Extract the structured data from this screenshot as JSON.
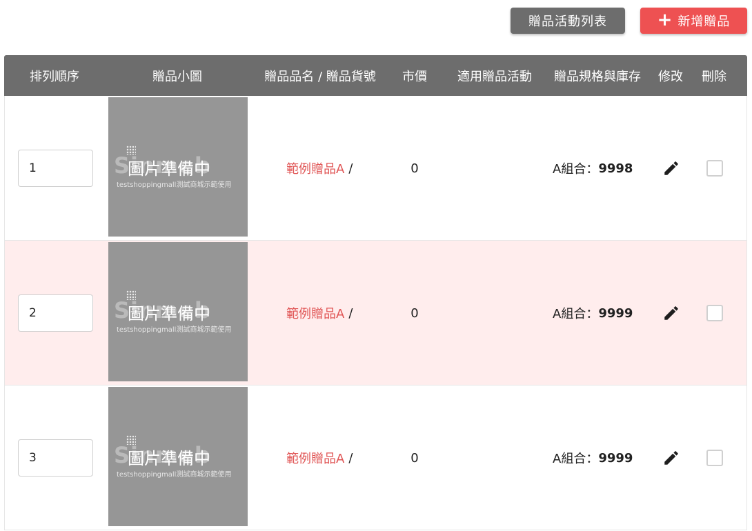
{
  "toolbar": {
    "list_label": "贈品活動列表",
    "add_label": "新增贈品",
    "add_icon": "plus-icon"
  },
  "table": {
    "headers": {
      "order": "排列順序",
      "thumbnail": "贈品小圖",
      "name_sku": "贈品品名 / 贈品貨號",
      "price": "市價",
      "campaign": "適用贈品活動",
      "spec_stock": "贈品規格與庫存",
      "edit": "修改",
      "delete": "刪除"
    },
    "rows": [
      {
        "order": "1",
        "thumb_watermark": "Sinmeb",
        "thumb_text": "圖片準備中",
        "thumb_subtext": "testshoppingmall測試商城示範使用",
        "name": "範例贈品A",
        "sku_sep": "/",
        "price": "0",
        "campaign": "",
        "spec_label": "A組合：",
        "stock": "9998",
        "highlight": false
      },
      {
        "order": "2",
        "thumb_watermark": "Sinmeb",
        "thumb_text": "圖片準備中",
        "thumb_subtext": "testshoppingmall測試商城示範使用",
        "name": "範例贈品A",
        "sku_sep": "/",
        "price": "0",
        "campaign": "",
        "spec_label": "A組合：",
        "stock": "9999",
        "highlight": true
      },
      {
        "order": "3",
        "thumb_watermark": "Sinmeb",
        "thumb_text": "圖片準備中",
        "thumb_subtext": "testshoppingmall測試商城示範使用",
        "name": "範例贈品A",
        "sku_sep": "/",
        "price": "0",
        "campaign": "",
        "spec_label": "A組合：",
        "stock": "9999",
        "highlight": false
      }
    ]
  },
  "colors": {
    "header_bg": "#6d6d6d",
    "add_button": "#ee5152",
    "highlight_row": "#ffeded",
    "gift_name": "#e05555"
  }
}
